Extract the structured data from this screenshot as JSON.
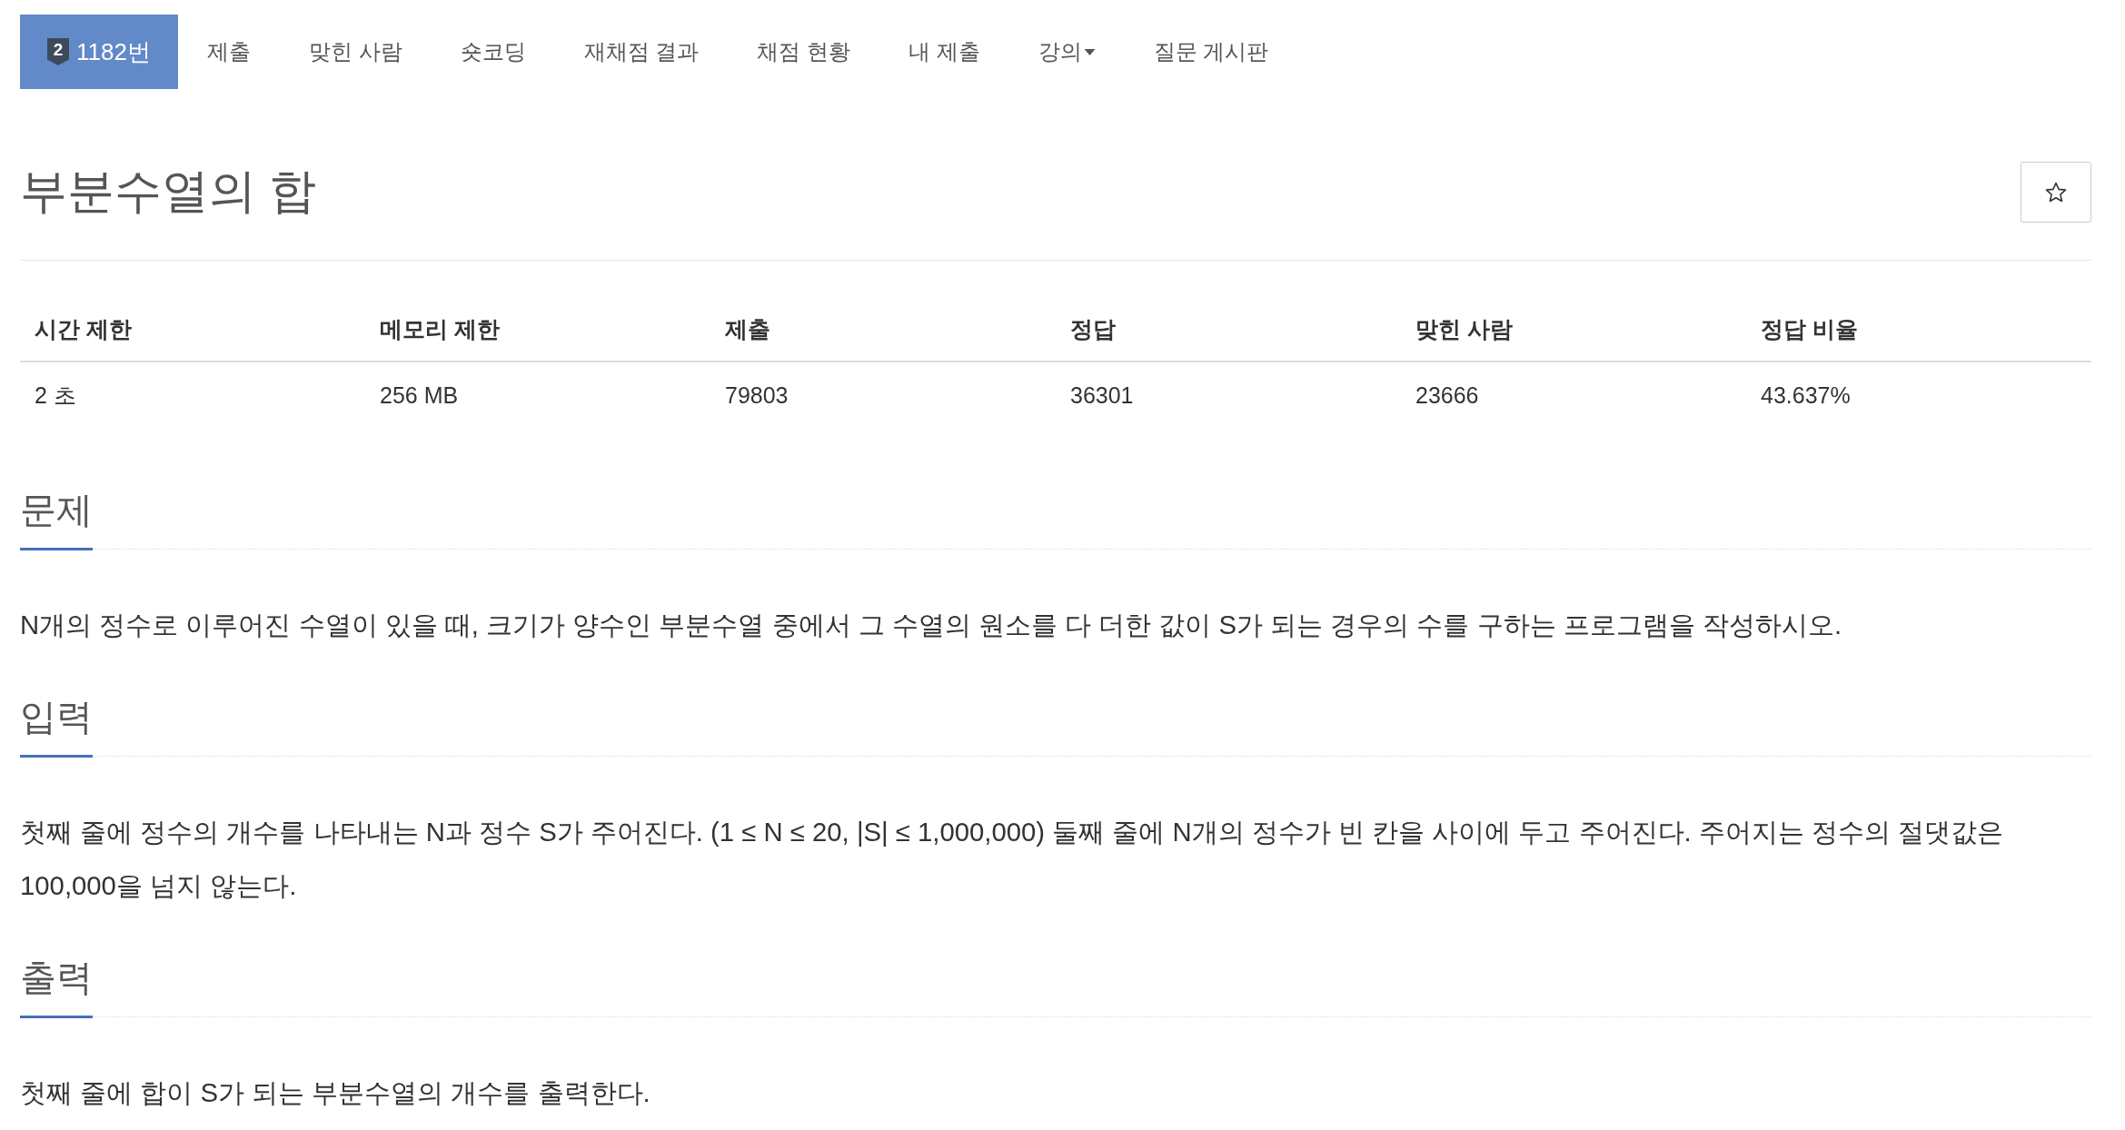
{
  "nav": {
    "tabs": [
      {
        "label": "1182번",
        "badge": "2",
        "selected": true,
        "has_menu": false
      },
      {
        "label": "제출",
        "selected": false,
        "has_menu": false
      },
      {
        "label": "맞힌 사람",
        "selected": false,
        "has_menu": false
      },
      {
        "label": "숏코딩",
        "selected": false,
        "has_menu": false
      },
      {
        "label": "재채점 결과",
        "selected": false,
        "has_menu": false
      },
      {
        "label": "채점 현황",
        "selected": false,
        "has_menu": false
      },
      {
        "label": "내 제출",
        "selected": false,
        "has_menu": false
      },
      {
        "label": "강의",
        "selected": false,
        "has_menu": true
      },
      {
        "label": "질문 게시판",
        "selected": false,
        "has_menu": false
      }
    ]
  },
  "problem": {
    "title": "부분수열의 합",
    "star_button": {
      "starred": false
    }
  },
  "info_table": {
    "columns": [
      "시간 제한",
      "메모리 제한",
      "제출",
      "정답",
      "맞힌 사람",
      "정답 비율"
    ],
    "rows": [
      [
        "2 초",
        "256 MB",
        "79803",
        "36301",
        "23666",
        "43.637%"
      ]
    ]
  },
  "sections": [
    {
      "heading": "문제",
      "paragraphs": [
        "N개의 정수로 이루어진 수열이 있을 때, 크기가 양수인 부분수열 중에서 그 수열의 원소를 다 더한 값이 S가 되는 경우의 수를 구하는 프로그램을 작성하시오."
      ]
    },
    {
      "heading": "입력",
      "paragraphs": [
        "첫째 줄에 정수의 개수를 나타내는 N과 정수 S가 주어진다. (1 ≤ N ≤ 20, |S| ≤ 1,000,000) 둘째 줄에 N개의 정수가 빈 칸을 사이에 두고 주어진다. 주어지는 정수의 절댓값은 100,000을 넘지 않는다."
      ]
    },
    {
      "heading": "출력",
      "paragraphs": [
        "첫째 줄에 합이 S가 되는 부분수열의 개수를 출력한다."
      ]
    }
  ]
}
